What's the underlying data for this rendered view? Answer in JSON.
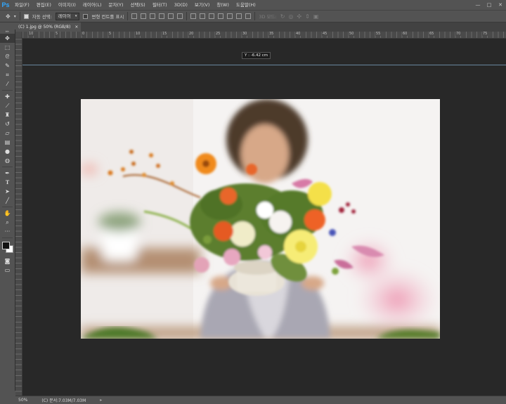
{
  "app": {
    "logo": "Ps"
  },
  "menu": [
    "파일(F)",
    "편집(E)",
    "이미지(I)",
    "레이어(L)",
    "문자(Y)",
    "선택(S)",
    "필터(T)",
    "3D(D)",
    "보기(V)",
    "창(W)",
    "도움말(H)"
  ],
  "window_controls": {
    "minimize": "—",
    "maximize": "□",
    "close": "✕"
  },
  "options": {
    "auto_select_label": "자동 선택:",
    "auto_select_value": "레이어",
    "transform_label": "변형 컨트롤 표시",
    "mode_3d_label": "3D 모드:"
  },
  "document_tab": {
    "title": "(C) 1.jpg @ 50% (RGB/8)",
    "close": "×"
  },
  "ruler_labels": [
    "10",
    "5",
    "0",
    "5",
    "10",
    "15",
    "20",
    "25",
    "30",
    "35",
    "40",
    "45",
    "50",
    "55",
    "60",
    "65",
    "70",
    "75"
  ],
  "coordinate_readout": "Y : -6.42 cm",
  "status": {
    "zoom": "50%",
    "doc_info": "(C) 문서:7.03M/7.03M",
    "arrow": "▸"
  },
  "colors": {
    "foreground": "#121212",
    "background": "#ffffff",
    "accent": "#31a8ff"
  },
  "tool_icons": [
    "move-icon",
    "marquee-icon",
    "lasso-icon",
    "quick-select-icon",
    "crop-icon",
    "eyedropper-icon",
    "healing-brush-icon",
    "brush-icon",
    "stamp-icon",
    "history-brush-icon",
    "eraser-icon",
    "gradient-icon",
    "blur-icon",
    "dodge-icon",
    "pen-icon",
    "type-icon",
    "path-select-icon",
    "line-icon",
    "hand-icon",
    "zoom-icon",
    "more-tools-icon"
  ]
}
